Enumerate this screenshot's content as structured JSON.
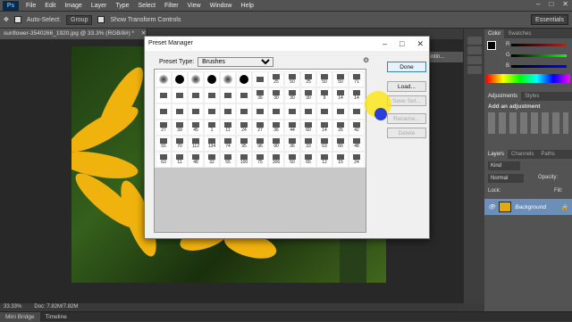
{
  "menubar": {
    "logo": "Ps",
    "items": [
      "File",
      "Edit",
      "Image",
      "Layer",
      "Type",
      "Select",
      "Filter",
      "View",
      "Window",
      "Help"
    ]
  },
  "options": {
    "auto_select_label": "Auto-Select:",
    "auto_select_value": "Group",
    "transform_label": "Show Transform Controls",
    "workspace": "Essentials"
  },
  "doc": {
    "tab_title": "sunflower-3540266_1920.jpg @ 33.3% (RGB/8#) *",
    "right_tab": "Paintin..."
  },
  "status": {
    "zoom": "33.33%",
    "doc_size": "Doc: 7.82M/7.82M"
  },
  "bottom": {
    "tabs": [
      "Mini Bridge",
      "Timeline"
    ]
  },
  "panels": {
    "color_tabs": [
      "Color",
      "Swatches"
    ],
    "channels": [
      "R",
      "G",
      "B"
    ],
    "adjust_tabs": [
      "Adjustments",
      "Styles"
    ],
    "adjust_title": "Add an adjustment",
    "layer_tabs": [
      "Layers",
      "Channels",
      "Paths"
    ],
    "kind": "Kind",
    "blend": "Normal",
    "opacity_label": "Opacity:",
    "lock_label": "Lock:",
    "fill_label": "Fill:",
    "layer_name": "Background"
  },
  "dialog": {
    "title": "Preset Manager",
    "preset_type_label": "Preset Type:",
    "preset_type_value": "Brushes",
    "buttons": {
      "done": "Done",
      "load": "Load...",
      "save": "Save Set...",
      "rename": "Rename...",
      "delete": "Delete"
    },
    "brush_numbers": [
      [
        "",
        "",
        "",
        "",
        "",
        "",
        "",
        "25",
        "50",
        "25",
        "50",
        "50",
        "71"
      ],
      [
        "",
        "",
        "",
        "",
        "",
        "",
        "36",
        "30",
        "30",
        "30",
        "9",
        "14",
        "14"
      ],
      [
        "",
        "",
        "",
        "",
        "",
        "",
        "",
        "",
        "",
        "",
        "",
        "",
        ""
      ],
      [
        "27",
        "39",
        "45",
        "1",
        "11",
        "24",
        "27",
        "36",
        "44",
        "60",
        "14",
        "26",
        "42"
      ],
      [
        "55",
        "70",
        "112",
        "134",
        "74",
        "95",
        "96",
        "90",
        "36",
        "33",
        "63",
        "66",
        "48"
      ],
      [
        "63",
        "11",
        "48",
        "32",
        "55",
        "100",
        "75",
        "306",
        "50",
        "65",
        "12",
        "15",
        "24"
      ],
      [
        "",
        "",
        "",
        "",
        "",
        "",
        "",
        "",
        "",
        "",
        "",
        "",
        ""
      ]
    ]
  }
}
